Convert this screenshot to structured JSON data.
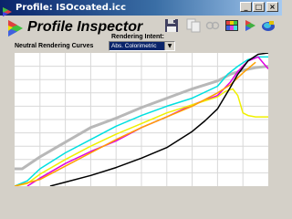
{
  "window": {
    "title": "Profile: ISOcoated.icc"
  },
  "app": {
    "name": "Profile Inspector"
  },
  "toolbar": [
    {
      "name": "save-icon",
      "color": "#404060"
    },
    {
      "name": "copy-icon",
      "color": "#c8c8c8"
    },
    {
      "name": "link-icon",
      "color": "#c8c8c8"
    },
    {
      "name": "palette-icon",
      "color": "#c04040"
    },
    {
      "name": "play-icon",
      "color": "#40a040"
    },
    {
      "name": "gamut-icon",
      "color": "#3050c0"
    }
  ],
  "labels": {
    "curves": "Neutral Rendering Curves",
    "rendering_intent": "Rendering Intent:"
  },
  "rendering_intent": {
    "selected": "Abs. Colorimetric"
  },
  "chart_data": {
    "type": "line",
    "title": "Neutral Rendering Curves",
    "grid": true,
    "grid_divisions": {
      "x": 10,
      "y": 10
    },
    "xlim": [
      0,
      100
    ],
    "ylim": [
      0,
      100
    ],
    "series": [
      {
        "color": "#b8b8b8",
        "x": [
          0,
          3,
          10,
          20,
          30,
          40,
          50,
          60,
          70,
          80,
          85,
          90,
          95,
          100
        ],
        "y": [
          13,
          13,
          22,
          33,
          44,
          51,
          59,
          66,
          73,
          79,
          84,
          87,
          89,
          90
        ]
      },
      {
        "color": "#00e0e0",
        "x": [
          0,
          5,
          10,
          20,
          30,
          40,
          50,
          60,
          70,
          80,
          84,
          88,
          92,
          96,
          100
        ],
        "y": [
          0,
          4,
          13,
          25,
          35,
          45,
          53,
          60,
          66,
          75,
          84,
          90,
          95,
          97,
          97
        ]
      },
      {
        "color": "#e000e0",
        "x": [
          5,
          10,
          20,
          30,
          40,
          50,
          60,
          70,
          80,
          85,
          88,
          92,
          96,
          100
        ],
        "y": [
          0,
          6,
          17,
          26,
          34,
          44,
          52,
          61,
          68,
          78,
          86,
          94,
          97,
          88
        ]
      },
      {
        "color": "#f0f000",
        "x": [
          0,
          5,
          10,
          20,
          30,
          40,
          50,
          60,
          70,
          80,
          83,
          86,
          88,
          90,
          92,
          95,
          100
        ],
        "y": [
          0,
          2,
          9,
          20,
          30,
          39,
          47,
          55,
          61,
          67,
          71,
          73,
          68,
          55,
          53,
          52,
          52
        ]
      },
      {
        "color": "#ffa000",
        "x": [
          0,
          10,
          20,
          30,
          40,
          50,
          60,
          70,
          80,
          85,
          90,
          95
        ],
        "y": [
          0,
          5,
          15,
          25,
          35,
          44,
          52,
          60,
          70,
          76,
          85,
          93
        ]
      },
      {
        "color": "#000000",
        "x": [
          14,
          20,
          30,
          40,
          50,
          60,
          70,
          75,
          80,
          85,
          88,
          92,
          96,
          100
        ],
        "y": [
          0,
          3,
          8,
          14,
          21,
          29,
          41,
          49,
          58,
          74,
          84,
          94,
          99,
          100
        ]
      }
    ]
  }
}
